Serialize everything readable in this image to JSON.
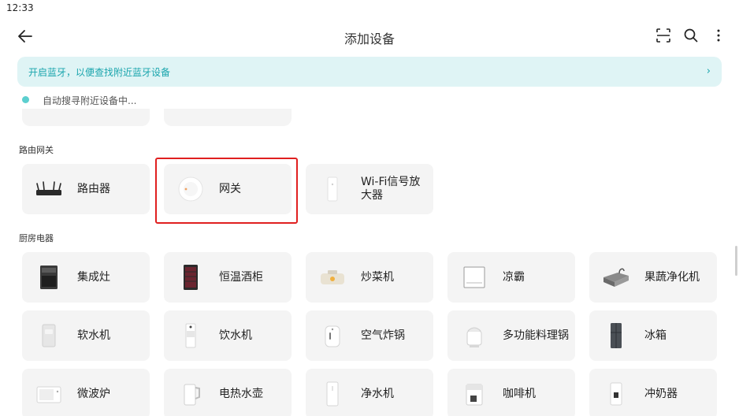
{
  "status_bar": {
    "time": "12:33"
  },
  "header": {
    "title": "添加设备"
  },
  "bluetooth_banner": {
    "text": "开启蓝牙，以便查找附近蓝牙设备",
    "chevron": "›"
  },
  "scan_status": {
    "text": "自动搜寻附近设备中..."
  },
  "sections": [
    {
      "title": "路由网关",
      "items": [
        {
          "label": "路由器",
          "icon": "router-icon"
        },
        {
          "label": "网关",
          "icon": "gateway-icon",
          "highlighted": true
        },
        {
          "label": "Wi-Fi信号放大器",
          "icon": "wifi-extender-icon"
        }
      ]
    },
    {
      "title": "厨房电器",
      "items": [
        {
          "label": "集成灶",
          "icon": "integrated-stove-icon"
        },
        {
          "label": "恒温酒柜",
          "icon": "wine-cabinet-icon"
        },
        {
          "label": "炒菜机",
          "icon": "cooking-machine-icon"
        },
        {
          "label": "凉霸",
          "icon": "cooler-icon"
        },
        {
          "label": "果蔬净化机",
          "icon": "produce-purifier-icon"
        },
        {
          "label": "软水机",
          "icon": "water-softener-icon"
        },
        {
          "label": "饮水机",
          "icon": "water-dispenser-icon"
        },
        {
          "label": "空气炸锅",
          "icon": "air-fryer-icon"
        },
        {
          "label": "多功能料理锅",
          "icon": "multi-cooker-icon"
        },
        {
          "label": "冰箱",
          "icon": "fridge-icon"
        },
        {
          "label": "微波炉",
          "icon": "microwave-icon"
        },
        {
          "label": "电热水壶",
          "icon": "kettle-icon"
        },
        {
          "label": "净水机",
          "icon": "water-purifier-icon"
        },
        {
          "label": "咖啡机",
          "icon": "coffee-machine-icon"
        },
        {
          "label": "冲奶器",
          "icon": "milk-maker-icon"
        }
      ]
    }
  ]
}
